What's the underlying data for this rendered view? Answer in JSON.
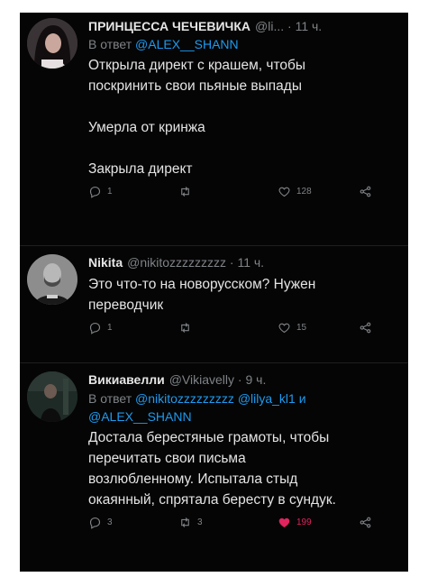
{
  "tweets": [
    {
      "name": "ПРИНЦЕССА ЧЕЧЕВИЧКА",
      "meta": "@li... · 11 ч.",
      "reply_prefix": "В ответ",
      "reply_mentions": "@ALEX__SHANN",
      "text": "Открыла директ с крашем, чтобы\nпоскринить свои пьяные выпады\n\nУмерла от кринжа\n\nЗакрыла директ",
      "replies": "1",
      "retweets": "",
      "likes": "128"
    },
    {
      "name": "Nikita",
      "meta": "@nikitozzzzzzzzz · 11 ч.",
      "text": "Это что-то на новорусском? Нужен\nпереводчик",
      "replies": "1",
      "retweets": "",
      "likes": "15"
    },
    {
      "name": "Викиавелли",
      "meta": "@Vikiavelly · 9 ч.",
      "reply_prefix": "В ответ",
      "reply_mentions": "@nikitozzzzzzzzz @lilya_kl1 и @ALEX__SHANN",
      "text": "Достала берестяные грамоты, чтобы\nперечитать свои письма\nвозлюбленному. Испытала стыд\nокаянный, спрятала бересту в сундук.",
      "replies": "3",
      "retweets": "3",
      "likes": "199"
    }
  ],
  "colors": {
    "background": "#050505",
    "text": "#e4e4e4",
    "muted": "#7f8387",
    "link": "#1d9bf0",
    "like_active": "#e0245e"
  },
  "icons": [
    "reply-icon",
    "retweet-icon",
    "like-icon",
    "share-icon"
  ]
}
